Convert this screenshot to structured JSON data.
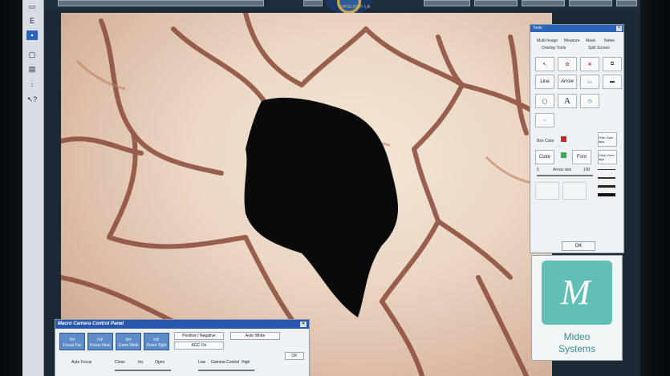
{
  "left_toolbar": {
    "items": [
      {
        "label": "E"
      },
      {
        "label": "?"
      }
    ]
  },
  "emblem": {
    "text": "OPOLOGY LA"
  },
  "tools_panel": {
    "title": "Tools",
    "tabs_row1": [
      "Multi-Image",
      "Measure",
      "Mask",
      "Notes"
    ],
    "tabs_row2": [
      "Overlay Tools",
      "Split Screen"
    ],
    "buttons": {
      "line": "Line",
      "arrow": "Arrow",
      "text_tool": "A",
      "box_color": "Box Color",
      "color": "Color",
      "font": "Font",
      "hide_overlays": "Hide Over-lays",
      "clear_overlays": "Clear Over-lays",
      "arrow_size": "Arrow size",
      "arrow_size_min": "5",
      "arrow_size_max": "100",
      "ok": "OK"
    },
    "accent_red": "#c0282a",
    "accent_green": "#3da85a"
  },
  "logo": {
    "letter": "M",
    "name_line1": "Mideo",
    "name_line2": "Systems"
  },
  "macro_panel": {
    "title": "Macro Camera Control Panel",
    "buttons": [
      {
        "label": "Focus Far",
        "icon": "arrow-left-icon"
      },
      {
        "label": "Focus Near",
        "icon": "arrow-right-icon"
      },
      {
        "label": "Zoom Wide",
        "icon": "arrow-left-icon"
      },
      {
        "label": "Zoom Tight",
        "icon": "arrow-right-icon"
      }
    ],
    "positive_negative": "Positive / Negative",
    "auto_white": "Auto White",
    "agc_on": "AGC On",
    "ok": "OK",
    "auto_focus": "Auto Focus",
    "close": "Close",
    "iris": "Iris",
    "open": "Open",
    "low": "Low",
    "gamma_control": "Gamma Control",
    "high": "High"
  }
}
